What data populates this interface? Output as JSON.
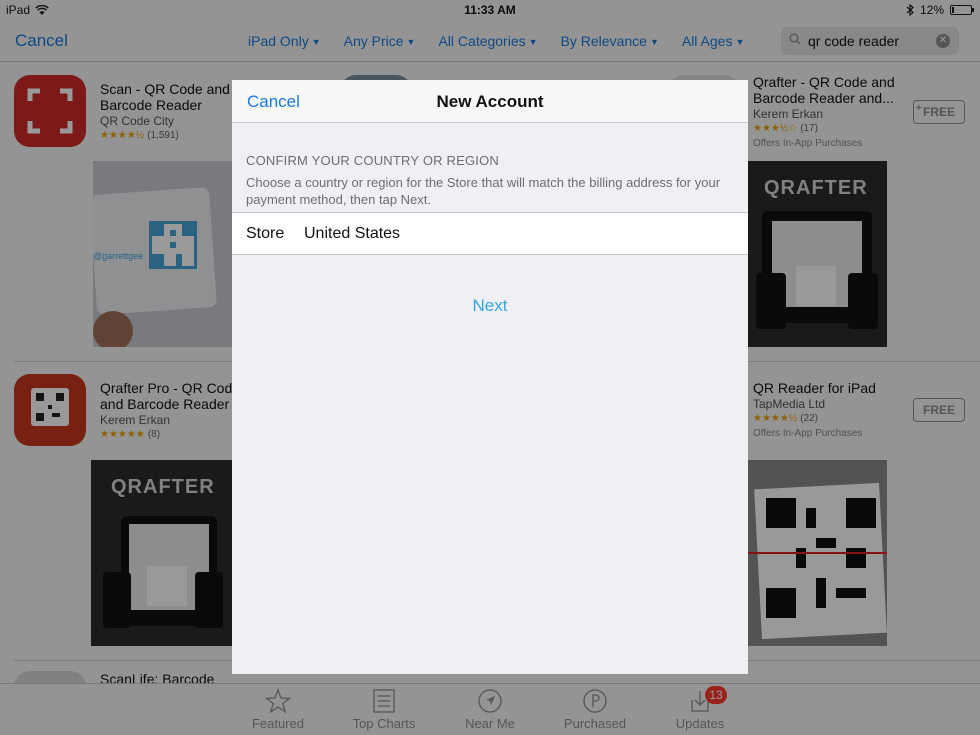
{
  "status_bar": {
    "device": "iPad",
    "time": "11:33 AM",
    "battery": "12%",
    "battery_level": 0.12
  },
  "nav": {
    "cancel": "Cancel",
    "filters": [
      {
        "label": "iPad Only"
      },
      {
        "label": "Any Price"
      },
      {
        "label": "All Categories"
      },
      {
        "label": "By Relevance"
      },
      {
        "label": "All Ages"
      }
    ],
    "search_value": "qr code reader"
  },
  "apps": [
    {
      "title_1": "Scan - QR Code and",
      "title_2": "Barcode Reader",
      "developer": "QR Code City",
      "stars": "★★★★½",
      "rating_count": "(1,591)"
    },
    {
      "title_1": "Qrafter - QR Code and",
      "title_2": "Barcode Reader and...",
      "developer": "Kerem Erkan",
      "stars": "★★★½☆",
      "rating_count": "(17)",
      "note": "Offers In-App Purchases",
      "price": "FREE",
      "screenshot_logo": "QRAFTER"
    },
    {
      "title_1": "Qrafter Pro - QR Cod",
      "title_2": "and Barcode Reader",
      "developer": "Kerem Erkan",
      "stars": "★★★★★",
      "rating_count": "(8)",
      "screenshot_logo": "QRAFTER"
    },
    {
      "title_1": "QR Reader for iPad",
      "developer": "TapMedia Ltd",
      "stars": "★★★★½",
      "rating_count": "(22)",
      "note": "Offers In-App Purchases",
      "price": "FREE"
    },
    {
      "title_1": "ScanLife: Barcode"
    }
  ],
  "scan_screenshot_text": "@garrettgee",
  "tabs": [
    {
      "label": "Featured",
      "icon": "star-icon"
    },
    {
      "label": "Top Charts",
      "icon": "list-icon"
    },
    {
      "label": "Near Me",
      "icon": "location-icon"
    },
    {
      "label": "Purchased",
      "icon": "purchased-icon"
    },
    {
      "label": "Updates",
      "icon": "updates-icon",
      "badge": "13"
    }
  ],
  "modal": {
    "cancel": "Cancel",
    "title": "New Account",
    "section_heading": "CONFIRM YOUR COUNTRY OR REGION",
    "description": "Choose a country or region for the Store that will match the billing address for your payment method, then tap Next.",
    "store_label": "Store",
    "store_value": "United States",
    "next": "Next"
  }
}
